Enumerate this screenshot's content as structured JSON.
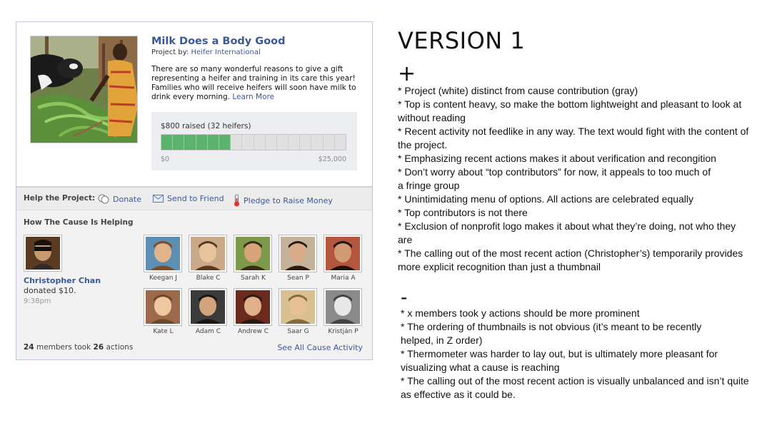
{
  "project": {
    "title": "Milk Does a Body Good",
    "by_label": "Project by:",
    "by_org": "Heifer International",
    "description": "There are so many wonderful reasons to give a gift representing a heifer and training in its care this year! Families who will receive heifers will soon have milk to drink every morning.",
    "learn_more": "Learn More"
  },
  "thermometer": {
    "raised_text": "$800 raised (32 heifers)",
    "min_label": "$0",
    "max_label": "$25,000",
    "segments_total": 16,
    "segments_filled": 6
  },
  "actions": {
    "label": "Help the Project:",
    "donate": "Donate",
    "send": "Send to Friend",
    "pledge": "Pledge to Raise Money"
  },
  "helping": {
    "title": "How The Cause Is Helping",
    "recent_name": "Christopher Chan",
    "recent_action": "donated $10.",
    "recent_time": "9:38pm",
    "members": [
      {
        "name": "Keegan J"
      },
      {
        "name": "Blake C"
      },
      {
        "name": "Sarah K"
      },
      {
        "name": "Sean P"
      },
      {
        "name": "Maria A"
      },
      {
        "name": "Kate L"
      },
      {
        "name": "Adam C"
      },
      {
        "name": "Andrew C"
      },
      {
        "name": "Saar G"
      },
      {
        "name": "Kristján P"
      }
    ],
    "stats_members": "24",
    "stats_mid": "members took",
    "stats_actions": "26",
    "stats_end": "actions",
    "see_all": "See All Cause Activity"
  },
  "notes": {
    "title": "VERSION 1",
    "plus_sign": "+",
    "plus_items": [
      "* Project (white) distinct from cause contribution (gray)",
      "* Top is content heavy, so make the bottom lightweight and pleasant to look at",
      "without reading",
      "* Recent activity not feedlike in any way. The text would fight with the content of",
      "the project.",
      "* Emphasizing recent actions makes it about verification and recongition",
      "* Don’t worry about “top contributors” for now, it appeals to too much of",
      "a fringe group",
      "* Unintimidating menu of options. All actions are celebrated equally",
      "* Top contributors is not there",
      "* Exclusion of nonprofit logo makes it about what they’re doing, not who they",
      "are",
      "* The calling out of the most recent action (Christopher’s) temporarily provides",
      "more explicit recognition than just a thumbnail"
    ],
    "minus_sign": "-",
    "minus_items": [
      "* x members took y actions should be more prominent",
      "* The ordering of thumbnails is not obvious (it’s meant to be recently",
      "helped, in Z order)",
      "* Thermometer was harder to lay out, but is ultimately more pleasant for",
      "visualizing what  a cause is reaching",
      "* The calling out of the most recent action is visually unbalanced and isn’t quite",
      "as effective as it could be."
    ]
  }
}
